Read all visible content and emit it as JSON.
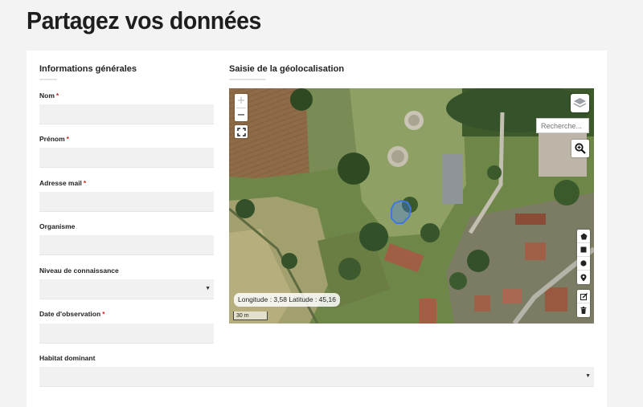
{
  "page": {
    "title": "Partagez vos données"
  },
  "general": {
    "title": "Informations générales",
    "required_marker": "*",
    "fields": {
      "nom": {
        "label": "Nom",
        "value": ""
      },
      "prenom": {
        "label": "Prénom",
        "value": ""
      },
      "email": {
        "label": "Adresse mail",
        "value": ""
      },
      "organisme": {
        "label": "Organisme",
        "value": ""
      },
      "niveau": {
        "label": "Niveau de connaissance",
        "value": ""
      },
      "date": {
        "label": "Date d'observation",
        "value": ""
      },
      "habitat": {
        "label": "Habitat dominant",
        "value": ""
      }
    }
  },
  "geo": {
    "title": "Saisie de la géolocalisation",
    "zoom_in": "+",
    "zoom_out": "−",
    "search_placeholder": "Recherche...",
    "coordinates": "Longitude : 3,58 Latitude : 45,16",
    "scale": "30 m",
    "icons": [
      "layers-icon",
      "fullscreen-icon",
      "zoom-search-icon",
      "polygon-icon",
      "rectangle-icon",
      "circle-icon",
      "marker-icon",
      "edit-icon",
      "trash-icon"
    ]
  }
}
